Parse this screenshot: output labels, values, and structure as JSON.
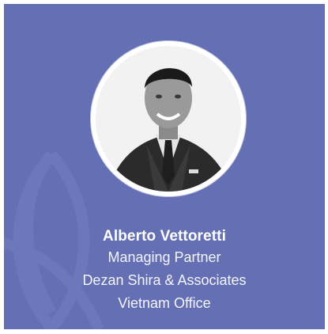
{
  "profile": {
    "name": "Alberto Vettoretti",
    "title": "Managing Partner",
    "company": "Dezan Shira & Associates",
    "office": "Vietnam Office"
  },
  "icons": {
    "watermark": "leaf-emblem-icon",
    "photo": "portrait-photo"
  },
  "colors": {
    "card_background": "#6470b3",
    "text": "#ffffff"
  }
}
